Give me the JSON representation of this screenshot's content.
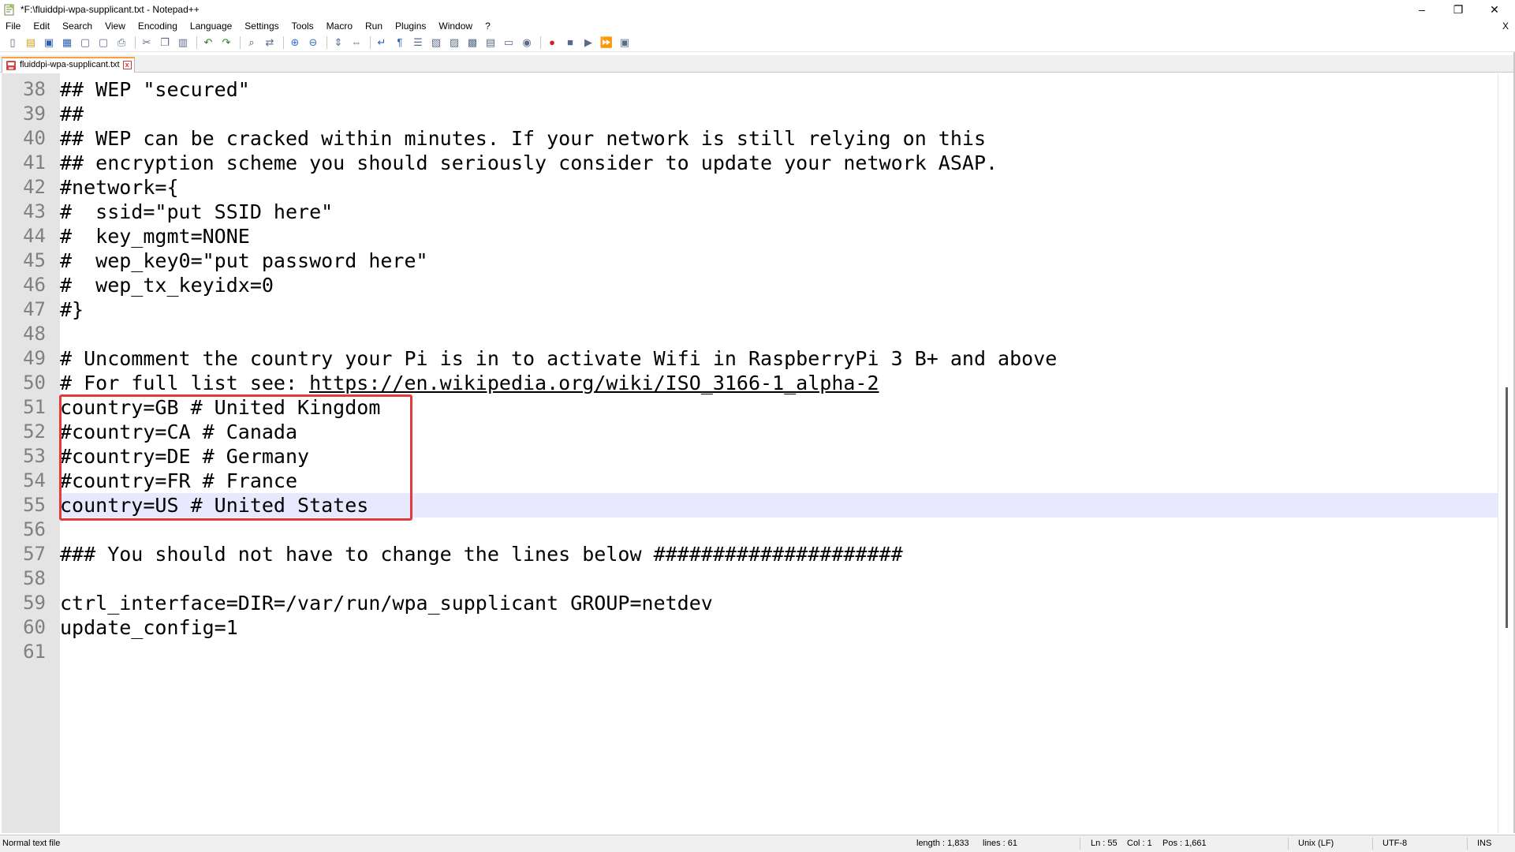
{
  "window": {
    "title": "*F:\\fluiddpi-wpa-supplicant.txt - Notepad++",
    "minimize": "–",
    "restore": "❐",
    "close": "✕"
  },
  "menu": {
    "items": [
      "File",
      "Edit",
      "Search",
      "View",
      "Encoding",
      "Language",
      "Settings",
      "Tools",
      "Macro",
      "Run",
      "Plugins",
      "Window",
      "?"
    ],
    "doc_close": "X"
  },
  "toolbar": {
    "icons": [
      "new-file-icon",
      "open-file-icon",
      "save-icon",
      "save-all-icon",
      "close-icon",
      "close-all-icon",
      "print-icon",
      "cut-icon",
      "copy-icon",
      "paste-icon",
      "undo-icon",
      "redo-icon",
      "find-icon",
      "replace-icon",
      "zoom-in-icon",
      "zoom-out-icon",
      "sync-vertical-icon",
      "sync-horizontal-icon",
      "word-wrap-icon",
      "show-all-chars-icon",
      "indent-guide-icon",
      "language-icon",
      "function-list-icon",
      "folder-workspace-icon",
      "document-map-icon",
      "doc-switcher-icon",
      "monitoring-icon",
      "record-macro-icon",
      "stop-record-icon",
      "play-macro-icon",
      "run-macro-multiple-icon",
      "save-macro-icon"
    ]
  },
  "tab": {
    "label": "fluiddpi-wpa-supplicant.txt",
    "close": "x"
  },
  "editor": {
    "lines": [
      {
        "num": "38",
        "text": "## WEP \"secured\""
      },
      {
        "num": "39",
        "text": "##"
      },
      {
        "num": "40",
        "text": "## WEP can be cracked within minutes. If your network is still relying on this"
      },
      {
        "num": "41",
        "text": "## encryption scheme you should seriously consider to update your network ASAP."
      },
      {
        "num": "42",
        "text": "#network={"
      },
      {
        "num": "43",
        "text": "#  ssid=\"put SSID here\""
      },
      {
        "num": "44",
        "text": "#  key_mgmt=NONE"
      },
      {
        "num": "45",
        "text": "#  wep_key0=\"put password here\""
      },
      {
        "num": "46",
        "text": "#  wep_tx_keyidx=0"
      },
      {
        "num": "47",
        "text": "#}"
      },
      {
        "num": "48",
        "text": ""
      },
      {
        "num": "49",
        "text": "# Uncomment the country your Pi is in to activate Wifi in RaspberryPi 3 B+ and above"
      },
      {
        "num": "50",
        "text": "# For full list see: ",
        "url": "https://en.wikipedia.org/wiki/ISO_3166-1_alpha-2"
      },
      {
        "num": "51",
        "text": "country=GB # United Kingdom"
      },
      {
        "num": "52",
        "text": "#country=CA # Canada"
      },
      {
        "num": "53",
        "text": "#country=DE # Germany"
      },
      {
        "num": "54",
        "text": "#country=FR # France"
      },
      {
        "num": "55",
        "text": "country=US # United States",
        "current": true
      },
      {
        "num": "56",
        "text": ""
      },
      {
        "num": "57",
        "text": "### You should not have to change the lines below #####################"
      },
      {
        "num": "58",
        "text": ""
      },
      {
        "num": "59",
        "text": "ctrl_interface=DIR=/var/run/wpa_supplicant GROUP=netdev"
      },
      {
        "num": "60",
        "text": "update_config=1"
      },
      {
        "num": "61",
        "text": ""
      }
    ]
  },
  "status": {
    "file_type": "Normal text file",
    "length": "length : 1,833",
    "lines": "lines : 61",
    "ln": "Ln : 55",
    "col": "Col : 1",
    "pos": "Pos : 1,661",
    "eol": "Unix (LF)",
    "encoding": "UTF-8",
    "mode": "INS"
  },
  "colors": {
    "highlight_box": "#e03c3c",
    "current_line": "#e8e8ff",
    "gutter": "#e4e4e4",
    "tab_accent": "#f7a23c"
  }
}
